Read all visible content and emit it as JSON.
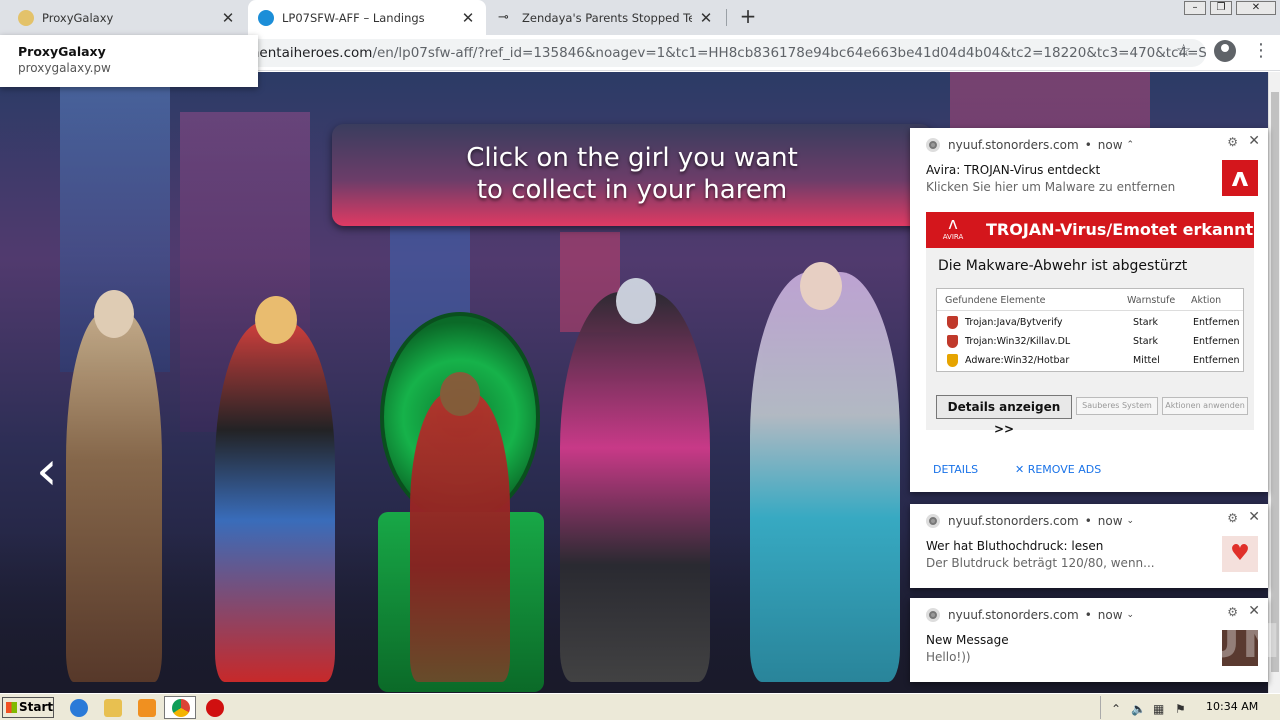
{
  "browser": {
    "tabs": [
      {
        "title": "ProxyGalaxy",
        "active": false
      },
      {
        "title": "LP07SFW-AFF – Landings",
        "active": true
      },
      {
        "title": "Zendaya's Parents Stopped Telling H",
        "active": false
      }
    ],
    "address_prefix": "g.hentaiheroes.com",
    "address_path": "/en/lp07sfw-aff/?ref_id=135846&noagev=1&tc1=HH8cb836178e94bc64e663be41d04d4b04&tc2=18220&tc3=470&tc4=S...",
    "suggestion": {
      "title": "ProxyGalaxy",
      "url": "proxygalaxy.pw"
    }
  },
  "page": {
    "banner_line1": "Click on the girl you want",
    "banner_line2": "to collect in your harem",
    "prev_arrow": "‹"
  },
  "notifications": [
    {
      "origin": "nyuuf.stonorders.com",
      "time": "now",
      "title": "Avira: TROJAN-Virus entdeckt",
      "body": "Klicken Sie hier um Malware zu entfernen",
      "card": {
        "logo_text": "AVIRA",
        "header": "TROJAN-Virus/Emotet erkannt",
        "subheading": "Die Makware-Abwehr ist abgestürzt",
        "columns": [
          "Gefundene Elemente",
          "Warnstufe",
          "Aktion"
        ],
        "rows": [
          {
            "name": "Trojan:Java/Bytverify",
            "level": "Stark",
            "action": "Entfernen",
            "color": "#c0392b"
          },
          {
            "name": "Trojan:Win32/Killav.DL",
            "level": "Stark",
            "action": "Entfernen",
            "color": "#c0392b"
          },
          {
            "name": "Adware:Win32/Hotbar",
            "level": "Mittel",
            "action": "Entfernen",
            "color": "#e6a400"
          }
        ],
        "details_button": "Details anzeigen >>",
        "clean_button": "Sauberes System",
        "apply_button": "Aktionen anwenden"
      },
      "actions": [
        "DETAILS",
        "REMOVE ADS"
      ]
    },
    {
      "origin": "nyuuf.stonorders.com",
      "time": "now",
      "title": "Wer hat Bluthochdruck: lesen",
      "body": "Der Blutdruck beträgt 120/80, wenn..."
    },
    {
      "origin": "nyuuf.stonorders.com",
      "time": "now",
      "title": "New Message",
      "body": "Hello!))"
    }
  ],
  "taskbar": {
    "start_label": "Start",
    "clock": "10:34 AM"
  },
  "watermark": "ANY.RUN",
  "colors": {
    "avira_red": "#d4161c",
    "link_blue": "#1a73e8",
    "banner_pink": "#e03a63"
  }
}
